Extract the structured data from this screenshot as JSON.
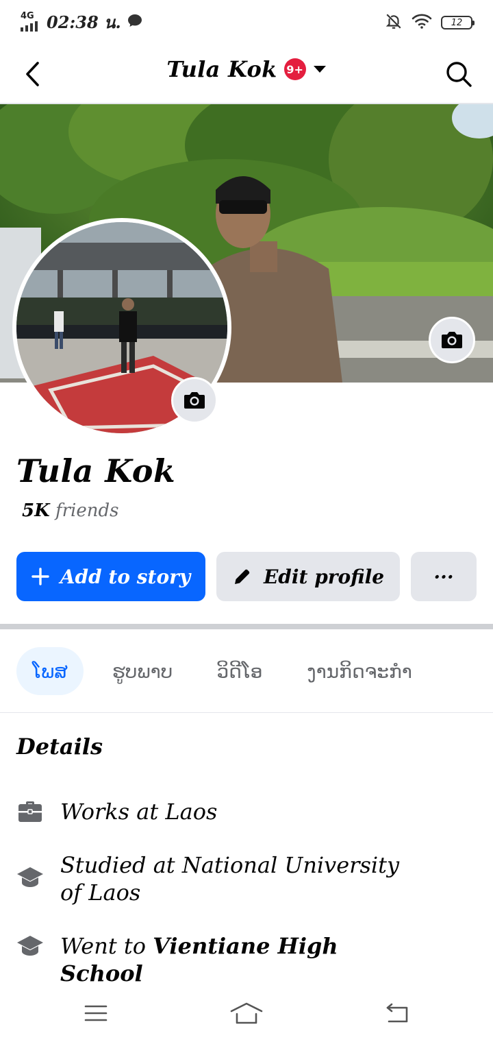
{
  "status_bar": {
    "network": "4G",
    "time": "02:38 น.",
    "battery": "12"
  },
  "header": {
    "title": "Tula Kok",
    "badge": "9+"
  },
  "profile": {
    "name": "Tula Kok",
    "friends_count": "5K",
    "friends_label": "friends"
  },
  "actions": {
    "add_story": "Add to story",
    "edit_profile": "Edit profile",
    "more": "···"
  },
  "tabs": [
    {
      "label": "ໂພສ",
      "active": true
    },
    {
      "label": "ຮູບພາບ",
      "active": false
    },
    {
      "label": "ວິດີໂອ",
      "active": false
    },
    {
      "label": "ງານກິດຈະກຳ",
      "active": false
    }
  ],
  "details": {
    "title": "Details",
    "items": [
      {
        "icon": "briefcase-icon",
        "prefix": "Works at Laos",
        "bold": ""
      },
      {
        "icon": "graduation-cap-icon",
        "prefix": "Studied at National University of Laos",
        "bold": ""
      },
      {
        "icon": "graduation-cap-icon",
        "prefix": "Went to ",
        "bold": "Vientiane High School"
      }
    ]
  },
  "colors": {
    "primary": "#0866ff",
    "badge": "#e41e3f",
    "secondary_button": "#e4e6eb",
    "muted_text": "#65676b"
  }
}
